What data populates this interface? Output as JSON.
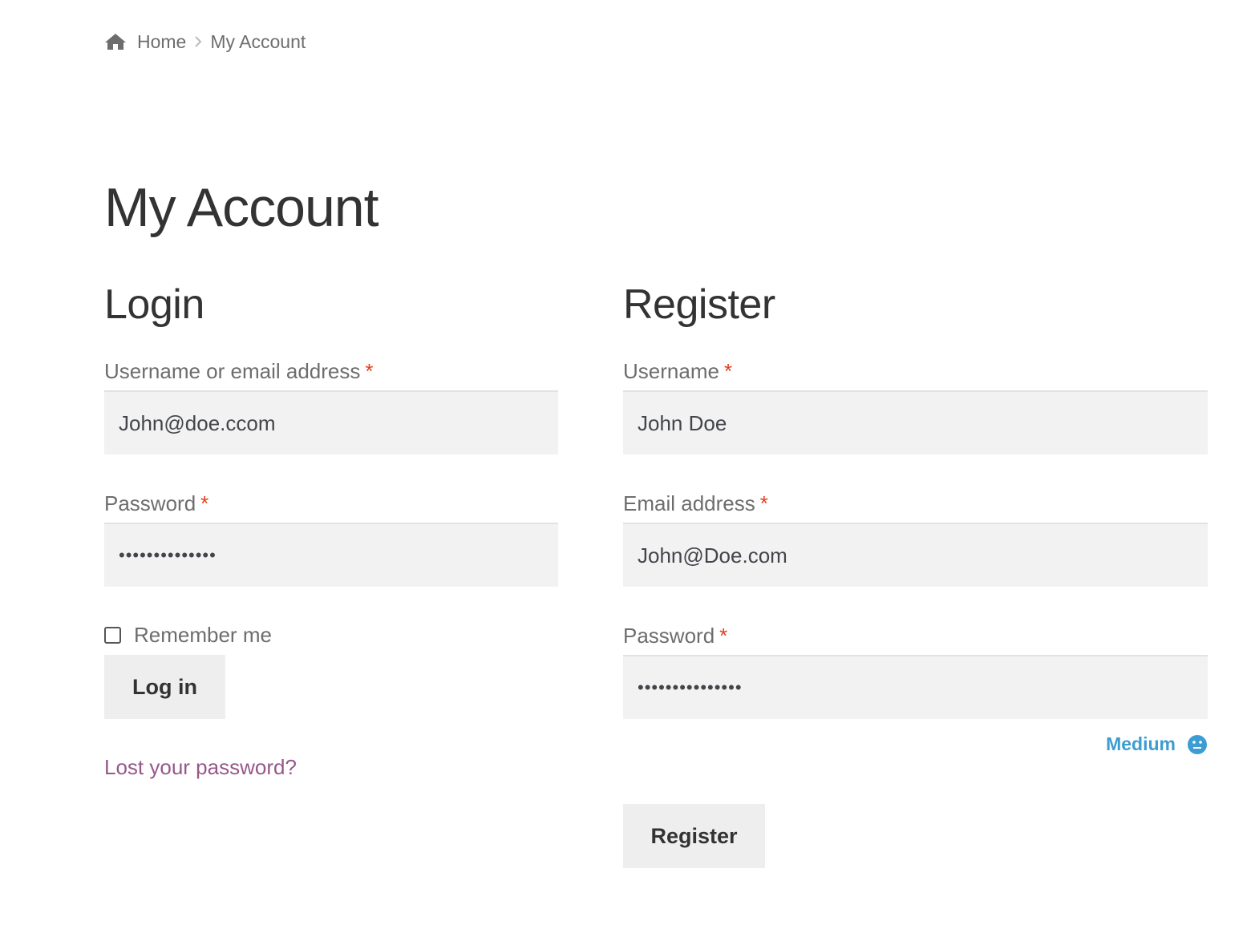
{
  "breadcrumb": {
    "home_icon": "home-icon",
    "home_label": "Home",
    "current_label": "My Account"
  },
  "page": {
    "title": "My Account"
  },
  "login": {
    "heading": "Login",
    "username_label": "Username or email address",
    "username_value": "John@doe.ccom",
    "password_label": "Password",
    "password_value": "••••••••••••••",
    "remember_label": "Remember me",
    "remember_checked": false,
    "login_button": "Log in",
    "lost_password_link": "Lost your password?"
  },
  "register": {
    "heading": "Register",
    "username_label": "Username",
    "username_value": "John Doe",
    "email_label": "Email address",
    "email_value": "John@Doe.com",
    "password_label": "Password",
    "password_value": "•••••••••••••••",
    "strength_label": "Medium",
    "strength_icon": "neutral-face-icon",
    "register_button": "Register"
  },
  "required_marker": "*",
  "colors": {
    "required": "#e2401c",
    "link": "#96588a",
    "strength": "#3d9cd2",
    "input_bg": "#f2f2f2",
    "button_bg": "#eeeeee"
  }
}
